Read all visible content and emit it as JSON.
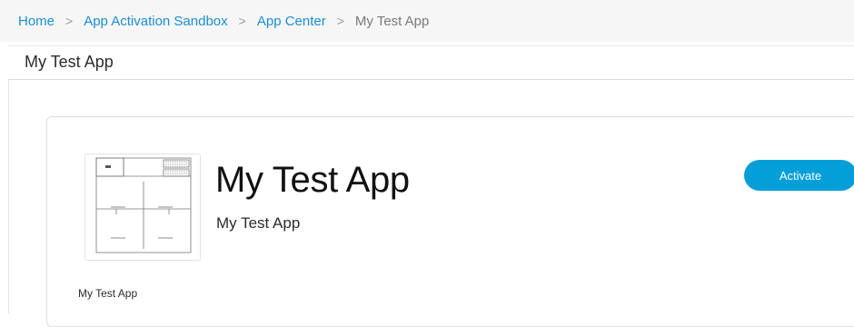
{
  "breadcrumb": {
    "items": [
      {
        "label": "Home",
        "link": true
      },
      {
        "label": "App Activation Sandbox",
        "link": true
      },
      {
        "label": "App Center",
        "link": true
      },
      {
        "label": "My Test App",
        "link": false
      }
    ],
    "separator": ">"
  },
  "page": {
    "title": "My Test App"
  },
  "app_card": {
    "name": "My Test App",
    "subtitle": "My Test App",
    "thumbnail_caption": "My Test App",
    "thumbnail_icon": "floor-plan-icon",
    "activate_label": "Activate"
  },
  "colors": {
    "link": "#1a8fce",
    "button": "#049fd9",
    "breadcrumb_bg": "#f6f6f6"
  }
}
